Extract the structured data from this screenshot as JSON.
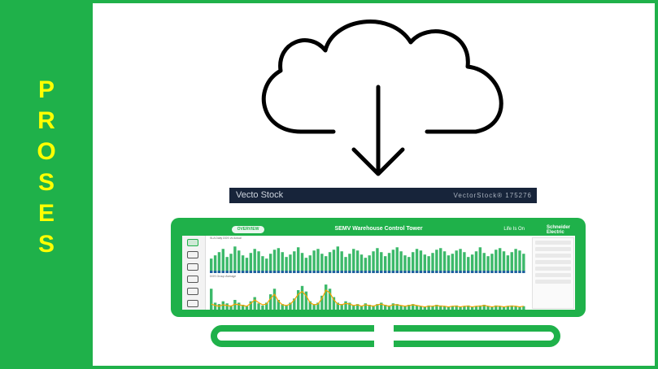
{
  "left_panel": {
    "letters": [
      "P",
      "R",
      "O",
      "S",
      "E",
      "S"
    ],
    "background_color": "#1fb14a",
    "text_color": "#ffff00"
  },
  "cloud_graphic": {
    "icon": "cloud-download-icon"
  },
  "watermark": {
    "brand": "Vecto Stock",
    "code": "VectorStock® 175276"
  },
  "dashboard": {
    "filter_pill": "OVERVIEW",
    "title": "SEMV Warehouse Control Tower",
    "tagline": "Life Is On",
    "logo_line1": "Schneider",
    "logo_line2": "Electric",
    "chart1_label": "SLA Daily DOS vs Actual",
    "chart2_label": "DOS Group Average",
    "accent_color": "#1fb14a",
    "line_color": "#f5a300",
    "bar_color": "#3cb96a",
    "bar_dark": "#1f5fa0"
  },
  "chart_data": [
    {
      "type": "bar",
      "values": [
        18,
        22,
        26,
        30,
        20,
        24,
        33,
        28,
        22,
        19,
        25,
        30,
        27,
        21,
        18,
        24,
        29,
        31,
        26,
        20,
        23,
        27,
        32,
        25,
        19,
        22,
        28,
        30,
        24,
        21,
        26,
        29,
        33,
        27,
        20,
        24,
        30,
        28,
        23,
        19,
        22,
        27,
        31,
        26,
        21,
        25,
        29,
        32,
        27,
        22,
        20,
        26,
        30,
        28,
        23,
        21,
        25,
        29,
        31,
        27,
        22,
        24,
        28,
        30,
        26,
        20,
        23,
        27,
        32,
        25,
        21,
        24,
        29,
        31,
        27,
        22,
        26,
        30,
        28,
        24
      ],
      "title": "",
      "xlabel": "",
      "ylabel": ""
    },
    {
      "type": "bar",
      "values": [
        30,
        10,
        8,
        12,
        9,
        6,
        14,
        10,
        7,
        5,
        12,
        18,
        9,
        6,
        10,
        22,
        30,
        14,
        8,
        6,
        10,
        16,
        28,
        34,
        26,
        12,
        8,
        10,
        20,
        36,
        30,
        18,
        10,
        8,
        12,
        10,
        6,
        8,
        5,
        9,
        7,
        6,
        8,
        10,
        7,
        6,
        9,
        8,
        6,
        5,
        7,
        8,
        6,
        5,
        4,
        6,
        5,
        7,
        6,
        5,
        4,
        5,
        6,
        4,
        5,
        6,
        4,
        5,
        6,
        7,
        5,
        4,
        6,
        5,
        4,
        5,
        6,
        5,
        4,
        5
      ],
      "line": [
        8,
        6,
        5,
        7,
        6,
        5,
        8,
        7,
        6,
        5,
        9,
        14,
        10,
        7,
        8,
        16,
        22,
        12,
        7,
        6,
        8,
        14,
        22,
        26,
        20,
        10,
        7,
        8,
        16,
        28,
        24,
        14,
        8,
        7,
        9,
        8,
        6,
        7,
        5,
        7,
        6,
        5,
        7,
        8,
        6,
        5,
        7,
        7,
        6,
        5,
        6,
        7,
        6,
        5,
        4,
        5,
        5,
        6,
        5,
        5,
        4,
        5,
        5,
        4,
        5,
        5,
        4,
        5,
        5,
        6,
        5,
        4,
        5,
        5,
        4,
        5,
        5,
        5,
        4,
        5
      ],
      "title": "",
      "xlabel": "",
      "ylabel": ""
    }
  ]
}
